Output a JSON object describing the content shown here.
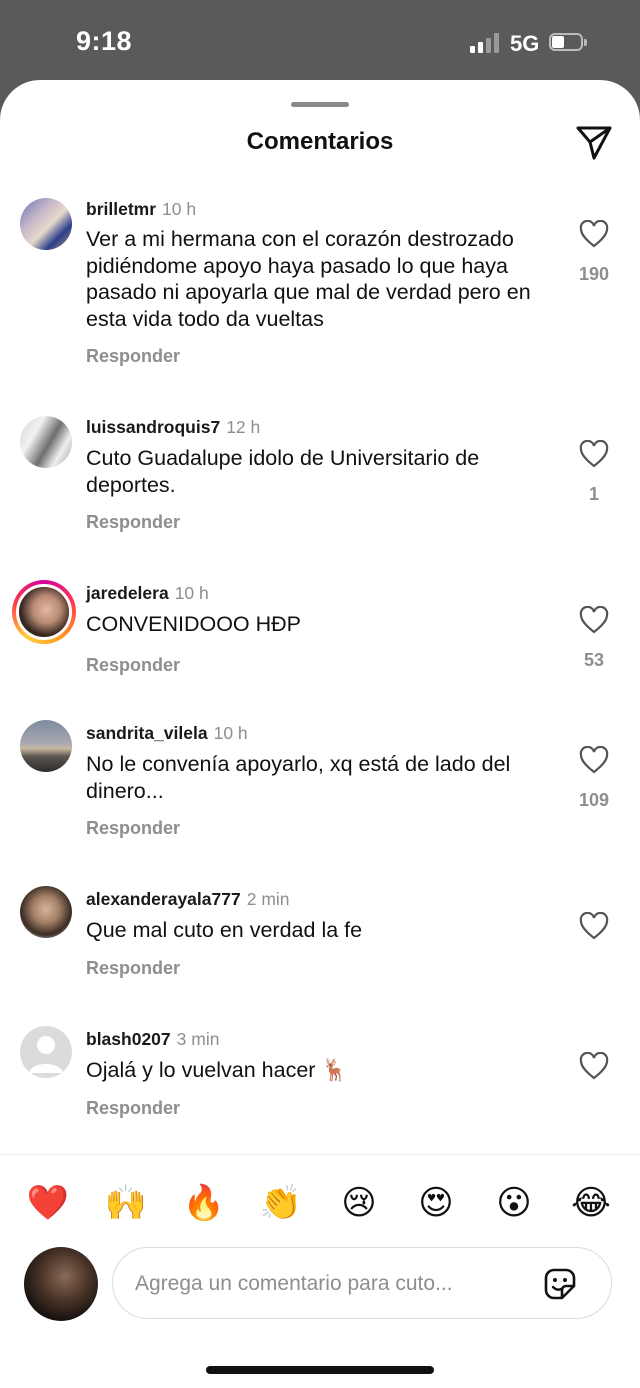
{
  "status_bar": {
    "time": "9:18",
    "network": "5G"
  },
  "sheet": {
    "title": "Comentarios",
    "share_icon": "paper-plane-icon"
  },
  "comments": [
    {
      "username": "brilletmr",
      "time": "10 h",
      "text": "Ver a mi hermana con el corazón destrozado pidiéndome apoyo haya pasado lo que haya pasado ni apoyarla que mal de verdad pero en esta vida todo da vueltas",
      "reply": "Responder",
      "likes": "190"
    },
    {
      "username": "luissandroquis7",
      "time": "12 h",
      "text": "Cuto Guadalupe idolo de Universitario de deportes.",
      "reply": "Responder",
      "likes": "1"
    },
    {
      "username": "jaredelera",
      "time": "10 h",
      "text": "CONVENIDOOO HĐP",
      "reply": "Responder",
      "likes": "53"
    },
    {
      "username": "sandrita_vilela",
      "time": "10 h",
      "text": "No le convenía apoyarlo, xq está de lado del dinero...",
      "reply": "Responder",
      "likes": "109"
    },
    {
      "username": "alexanderayala777",
      "time": "2 min",
      "text": "Que mal cuto en verdad la fe",
      "reply": "Responder",
      "likes": ""
    },
    {
      "username": "blash0207",
      "time": "3 min",
      "text": "Ojalá y lo vuelvan hacer 🦌",
      "reply": "Responder",
      "likes": ""
    }
  ],
  "emoji_bar": [
    "❤️",
    "🙌",
    "🔥",
    "👏",
    "😢",
    "😍",
    "😮",
    "😂"
  ],
  "composer": {
    "placeholder": "Agrega un comentario para cuto...",
    "sticker_icon": "sticker-icon"
  },
  "colors": {
    "secondary_text": "#8e8e8e",
    "story_ring": "#ff3a4e"
  }
}
